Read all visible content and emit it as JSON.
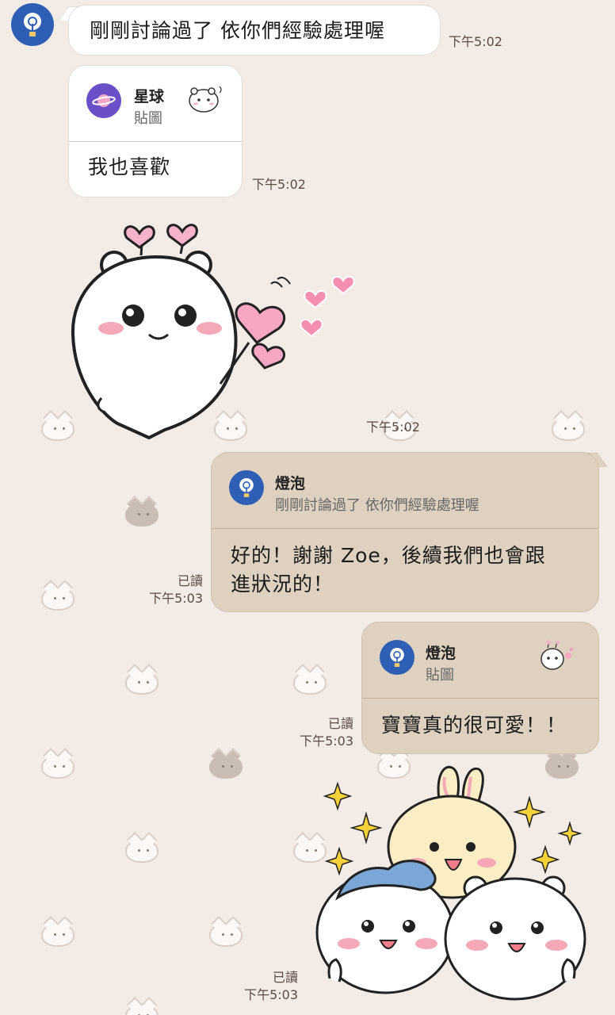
{
  "messages": {
    "m1": {
      "text": "剛剛討論過了 依你們經驗處理喔",
      "time": "下午5:02"
    },
    "m2": {
      "reply_name": "星球",
      "reply_sub": "貼圖",
      "text": "我也喜歡",
      "time": "下午5:02"
    },
    "m3": {
      "time": "下午5:02"
    },
    "m4": {
      "reply_name": "燈泡",
      "reply_sub": "剛剛討論過了 依你們經驗處理喔",
      "text_line1": "好的！謝謝 Zoe，後續我們也會跟",
      "text_line2": "進狀況的！",
      "read": "已讀",
      "time": "下午5:03"
    },
    "m5": {
      "reply_name": "燈泡",
      "reply_sub": "貼圖",
      "text": "寶寶真的很可愛！！",
      "read": "已讀",
      "time": "下午5:03"
    },
    "m6": {
      "read": "已讀",
      "time": "下午5:03"
    }
  },
  "icons": {
    "avatar": "lightbulb-icon",
    "planet": "planet-icon"
  },
  "colors": {
    "background": "#f2ebe6",
    "my_bubble": "#ded1c0",
    "their_bubble": "#ffffff",
    "avatar_blue": "#2f5fb5",
    "planet_purple": "#6a4fc9"
  }
}
